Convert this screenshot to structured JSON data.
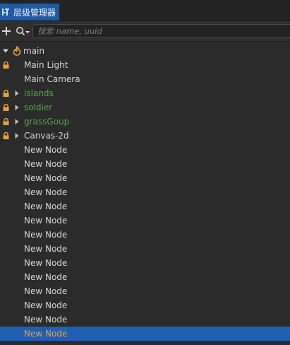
{
  "panel": {
    "tab_label": "层级管理器",
    "tab_icon": "hierarchy-icon"
  },
  "toolbar": {
    "add_icon": "plus-icon",
    "search_icon": "search-icon",
    "search_placeholder": "搜索 name, uuid",
    "search_value": ""
  },
  "colors": {
    "accent": "#1f5fb5",
    "lock": "#e8a03a",
    "prefab_green": "#57a64a",
    "selected_text": "#e8a03a"
  },
  "tree": {
    "root": {
      "label": "main",
      "icon": "scene-icon",
      "expanded": true
    },
    "nodes": [
      {
        "label": "Main Light",
        "locked": true,
        "arrow": false,
        "style": "normal"
      },
      {
        "label": "Main Camera",
        "locked": false,
        "arrow": false,
        "style": "normal"
      },
      {
        "label": "islands",
        "locked": true,
        "arrow": true,
        "style": "green"
      },
      {
        "label": "soldier",
        "locked": true,
        "arrow": true,
        "style": "green"
      },
      {
        "label": "grassGoup",
        "locked": true,
        "arrow": true,
        "style": "green"
      },
      {
        "label": "Canvas-2d",
        "locked": true,
        "arrow": true,
        "style": "normal"
      },
      {
        "label": "New Node",
        "locked": false,
        "arrow": false,
        "style": "normal"
      },
      {
        "label": "New Node",
        "locked": false,
        "arrow": false,
        "style": "normal"
      },
      {
        "label": "New Node",
        "locked": false,
        "arrow": false,
        "style": "normal"
      },
      {
        "label": "New Node",
        "locked": false,
        "arrow": false,
        "style": "normal"
      },
      {
        "label": "New Node",
        "locked": false,
        "arrow": false,
        "style": "normal"
      },
      {
        "label": "New Node",
        "locked": false,
        "arrow": false,
        "style": "normal"
      },
      {
        "label": "New Node",
        "locked": false,
        "arrow": false,
        "style": "normal"
      },
      {
        "label": "New Node",
        "locked": false,
        "arrow": false,
        "style": "normal"
      },
      {
        "label": "New Node",
        "locked": false,
        "arrow": false,
        "style": "normal"
      },
      {
        "label": "New Node",
        "locked": false,
        "arrow": false,
        "style": "normal"
      },
      {
        "label": "New Node",
        "locked": false,
        "arrow": false,
        "style": "normal"
      },
      {
        "label": "New Node",
        "locked": false,
        "arrow": false,
        "style": "normal"
      },
      {
        "label": "New Node",
        "locked": false,
        "arrow": false,
        "style": "normal"
      },
      {
        "label": "New Node",
        "locked": false,
        "arrow": false,
        "style": "selected"
      }
    ]
  }
}
